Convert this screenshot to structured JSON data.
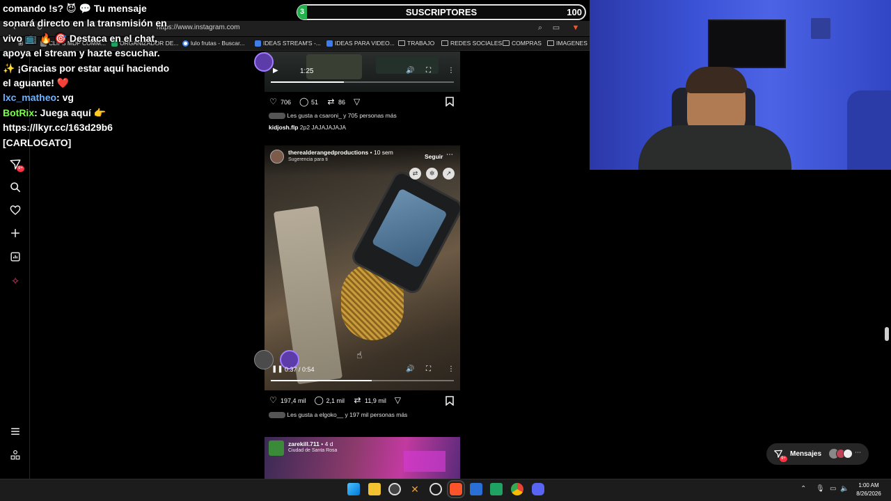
{
  "browser": {
    "url": "https://www.instagram.com",
    "bookmarks": [
      {
        "label": "CLIPS MDP COMM...",
        "type": "page"
      },
      {
        "label": "ORGANIZADOR DE...",
        "type": "sheet"
      },
      {
        "label": "lulo frutas - Buscar...",
        "type": "google"
      },
      {
        "label": "IDEAS STREAM'S -...",
        "type": "doc"
      },
      {
        "label": "IDEAS PARA VIDEO...",
        "type": "doc"
      },
      {
        "label": "TRABAJO",
        "type": "folder"
      },
      {
        "label": "REDES SOCIALES",
        "type": "folder"
      },
      {
        "label": "COMPRAS",
        "type": "folder"
      },
      {
        "label": "IMAGENES",
        "type": "folder"
      }
    ]
  },
  "chat": {
    "intro": "comando !s? 😈 💬 Tu mensaje sonará directo en la transmisión en vivo 📺 🔥 🎯 Destaca en el chat, apoya el stream y hazte escuchar. ✨ ¡Gracias por estar aquí haciendo el aguante! ❤️",
    "msg1_user": "lxc_matheo",
    "msg1_text": ": vg",
    "msg2_user": "BotRix",
    "msg2_text": ": Juega aquí 👉 https://lkyr.cc/163d29b6 [CARLOGATO]"
  },
  "subscribers": {
    "count": "3",
    "label": "SUSCRIPTORES",
    "goal": "100",
    "progress_fraction": 0.03
  },
  "sidebar": {
    "notifications_badge": "9+"
  },
  "post1": {
    "time": "1:25",
    "likes": "706",
    "comments": "51",
    "reposts": "86",
    "liked_by": "Les gusta a csaroni_ y 705 personas más",
    "liked_by_user": "csaroni_",
    "caption_user": "kidjosh.flp",
    "caption_text": "2p2 JAJAJAJAJA",
    "progress_fraction": 0.4
  },
  "post2": {
    "username": "therealderangedproductions",
    "age": "• 10 sem",
    "subtitle": "Sugerencia para ti",
    "follow": "Seguir",
    "time": "0:37 / 0:54",
    "likes": "197,4 mil",
    "comments": "2,1 mil",
    "reposts": "11,9 mil",
    "liked_by": "Les gusta a elgoko__ y 197 mil personas más",
    "progress_fraction": 0.55
  },
  "post3": {
    "username": "zarekill.711",
    "age": "• 4 d",
    "location": "Ciudad de Santa Rosa"
  },
  "messages": {
    "label": "Mensajes",
    "badge": "9+"
  },
  "taskbar": {
    "time": "1:00 AM",
    "date": "8/26/2026"
  }
}
